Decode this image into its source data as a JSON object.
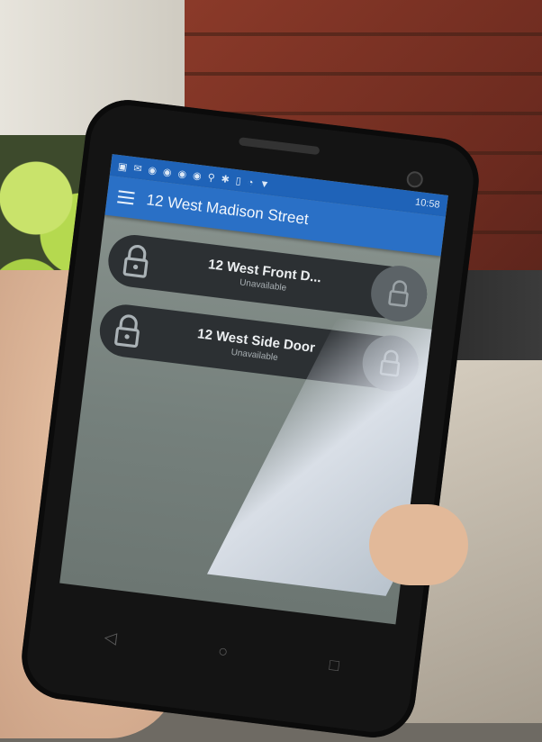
{
  "status_bar": {
    "time": "10:58"
  },
  "app_bar": {
    "title": "12 West Madison Street",
    "menu_icon": "hamburger-menu-icon"
  },
  "locks": [
    {
      "name": "12 West Front D...",
      "status": "Unavailable",
      "icon": "padlock-icon"
    },
    {
      "name": "12 West Side Door",
      "status": "Unavailable",
      "icon": "padlock-icon"
    }
  ],
  "nav_bar": {
    "back_icon": "◁",
    "home_icon": "○",
    "recents_icon": "□"
  },
  "colors": {
    "status_bar": "#1f63b8",
    "app_bar": "#2a70c6",
    "lock_pill": "#2c3033"
  }
}
